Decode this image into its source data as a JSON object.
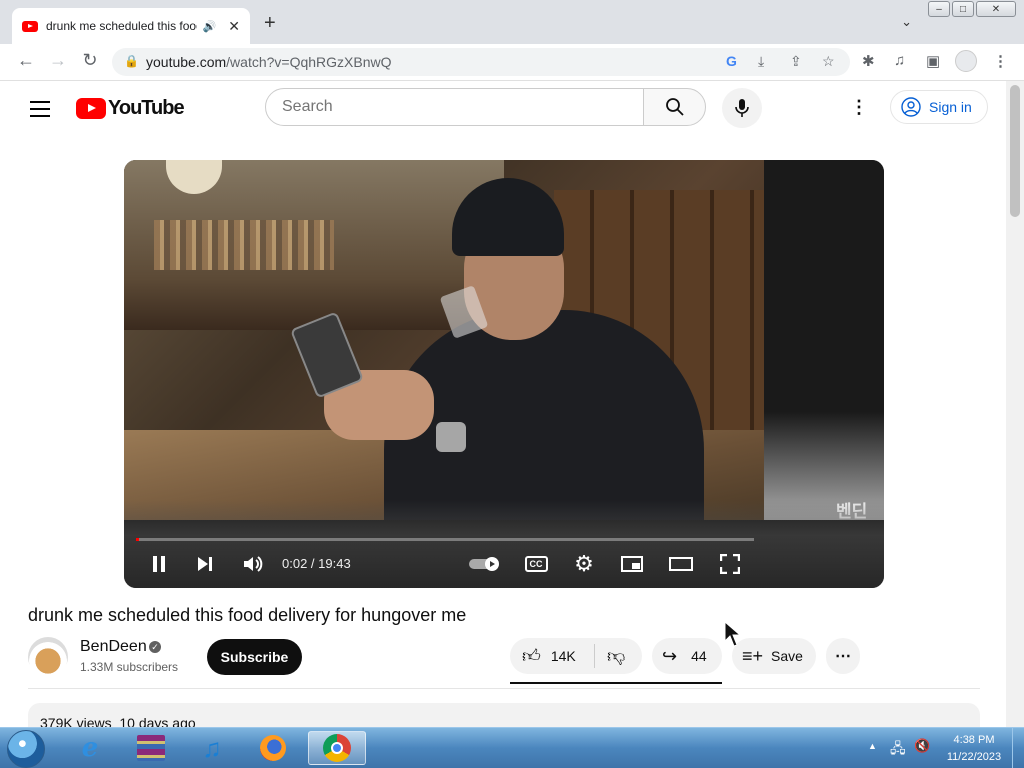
{
  "browser": {
    "tab_title": "drunk me scheduled this food delivery for hungover me",
    "url_host": "youtube.com",
    "url_path": "/watch?v=QqhRGzXBnwQ",
    "window_controls": [
      "–",
      "□",
      "✕"
    ],
    "new_tab_symbol": "+",
    "tabs_menu_symbol": "⌄"
  },
  "youtube": {
    "logo_text": "YouTube",
    "search_placeholder": "Search",
    "signin_label": "Sign in"
  },
  "player": {
    "current_time": "0:02",
    "duration": "19:43",
    "time_display": "0:02 / 19:43",
    "progress_fraction": 0.0017,
    "watermark_text": "벤딘",
    "cc_label": "CC"
  },
  "video": {
    "title": "drunk me scheduled this food delivery for hungover me",
    "channel_name": "BenDeen",
    "subscribers": "1.33M subscribers",
    "subscribe_label": "Subscribe",
    "likes": "14K",
    "shares": "44",
    "save_label": "Save",
    "views_date": "379K views  10 days ago"
  },
  "taskbar": {
    "time": "4:38 PM",
    "date": "11/22/2023",
    "apps": [
      "internet-explorer",
      "winrar",
      "itunes",
      "firefox",
      "chrome"
    ],
    "active_app": "chrome"
  },
  "colors": {
    "youtube_red": "#ff0000",
    "link_blue": "#065fd4",
    "subscribe_black": "#0f0f0f",
    "taskbar_blue": "#4b86be"
  }
}
